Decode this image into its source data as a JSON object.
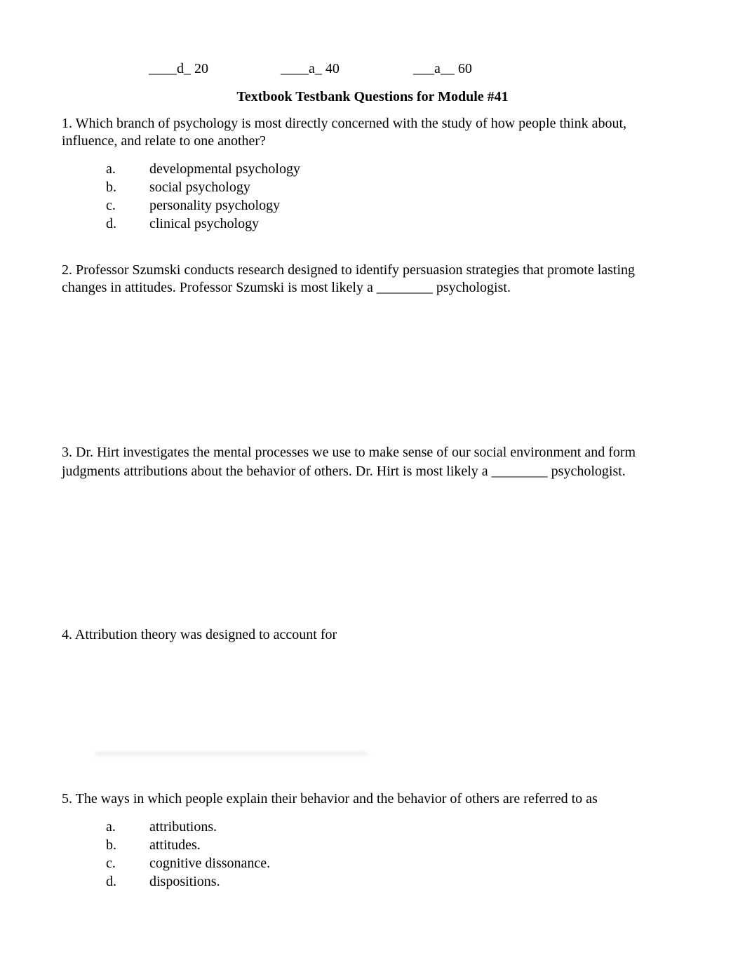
{
  "answer_key": [
    {
      "blank": "____d_",
      "number": "20"
    },
    {
      "blank": "____a_",
      "number": "40"
    },
    {
      "blank": "___a__",
      "number": "60"
    }
  ],
  "title": "Textbook Testbank Questions for Module #41",
  "questions": [
    {
      "text": "1. Which branch of psychology is most directly concerned with the study of how people think about, influence, and relate to one another?",
      "options": [
        {
          "letter": "a.",
          "text": "developmental psychology"
        },
        {
          "letter": "b.",
          "text": "social psychology"
        },
        {
          "letter": "c.",
          "text": "personality psychology"
        },
        {
          "letter": "d.",
          "text": "clinical psychology"
        }
      ]
    },
    {
      "text": "2. Professor Szumski conducts research designed to identify persuasion strategies that promote lasting changes in attitudes. Professor Szumski is most likely a ________ psychologist."
    },
    {
      "text": "3. Dr. Hirt investigates the mental processes we use to make sense of our social environment and form judgments attributions about the behavior of others. Dr. Hirt is most likely a ________ psychologist."
    },
    {
      "text": "4. Attribution theory was designed to account for"
    },
    {
      "text": "5. The ways in which people explain their behavior and the behavior of others are referred to as",
      "options": [
        {
          "letter": "a.",
          "text": "attributions."
        },
        {
          "letter": "b.",
          "text": "attitudes."
        },
        {
          "letter": "c.",
          "text": "cognitive dissonance."
        },
        {
          "letter": "d.",
          "text": "dispositions."
        }
      ]
    }
  ]
}
